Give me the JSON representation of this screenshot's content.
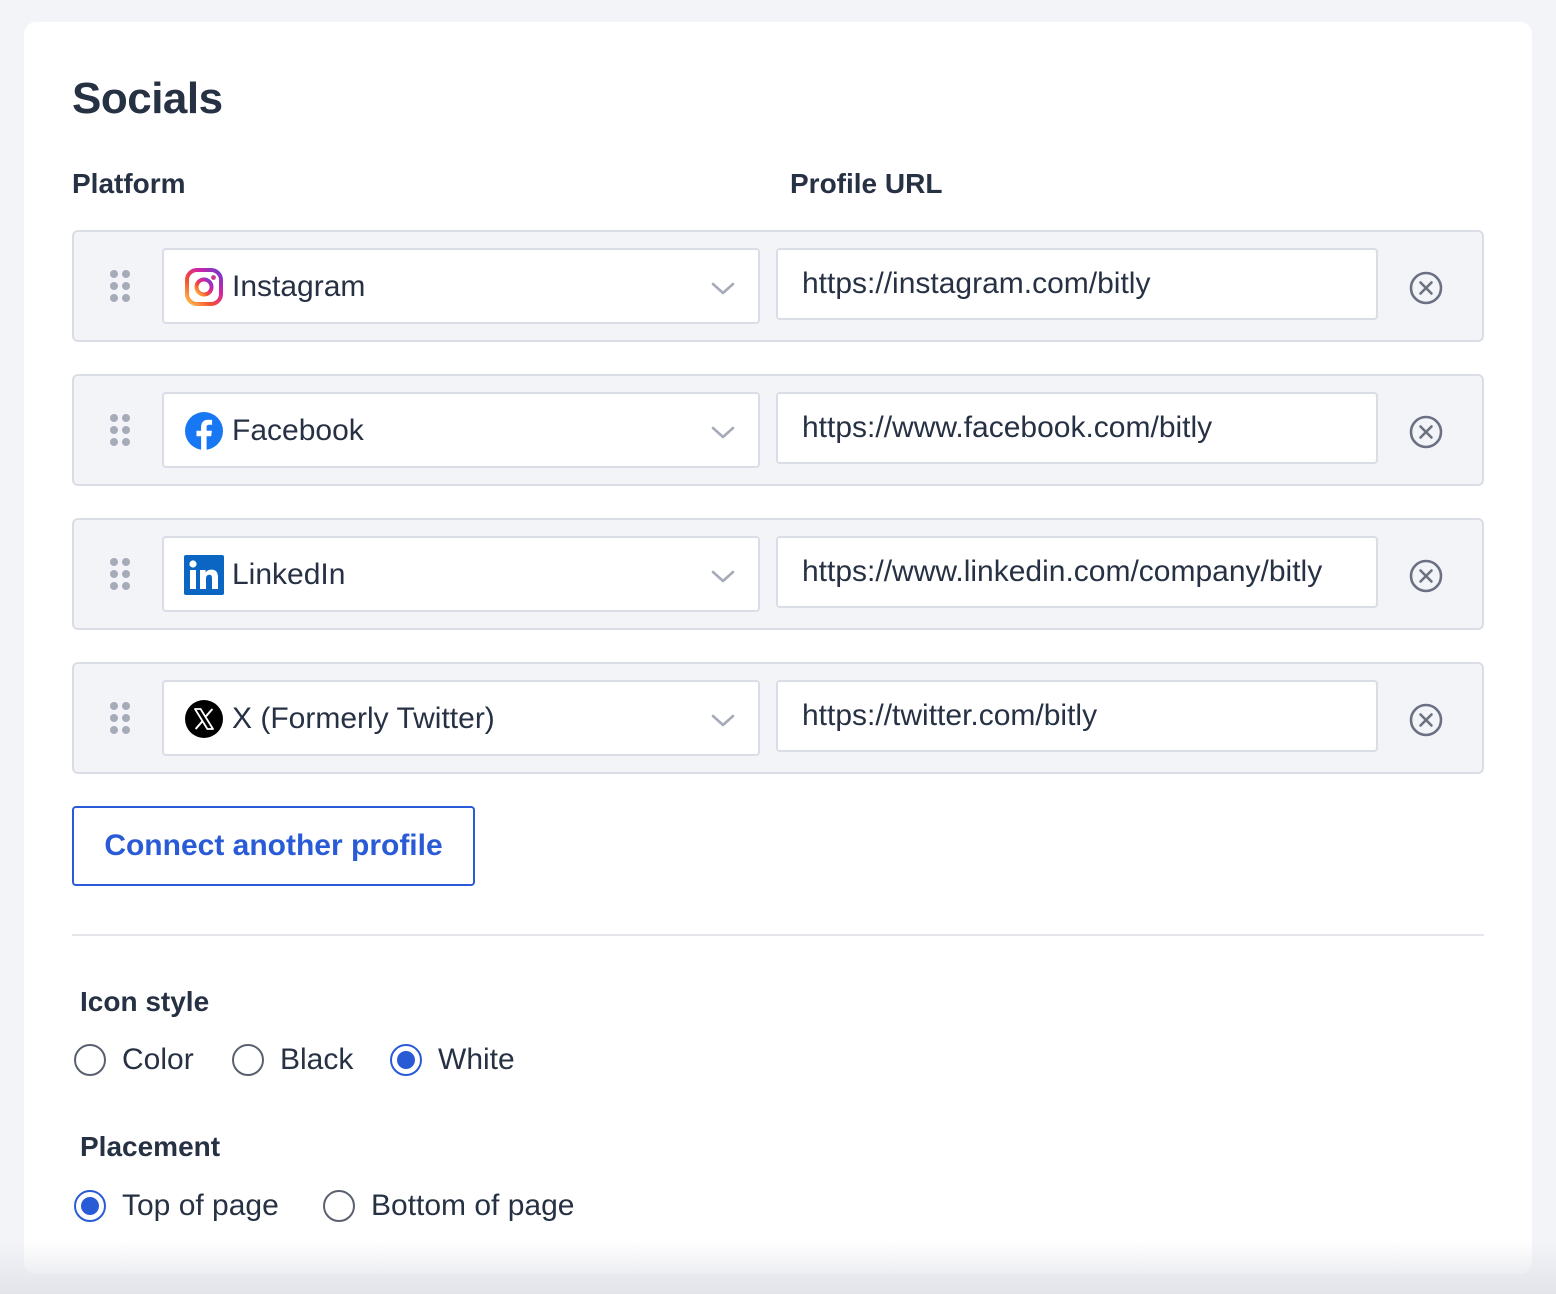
{
  "section": {
    "title": "Socials"
  },
  "columns": {
    "platform": "Platform",
    "profile_url": "Profile URL"
  },
  "socials": [
    {
      "platform": "Instagram",
      "icon": "instagram-icon",
      "url": "https://instagram.com/bitly"
    },
    {
      "platform": "Facebook",
      "icon": "facebook-icon",
      "url": "https://www.facebook.com/bitly"
    },
    {
      "platform": "LinkedIn",
      "icon": "linkedin-icon",
      "url": "https://www.linkedin.com/company/bitly"
    },
    {
      "platform": "X (Formerly Twitter)",
      "icon": "x-twitter-icon",
      "url": "https://twitter.com/bitly"
    }
  ],
  "connect_button": {
    "label": "Connect another profile"
  },
  "icon_style": {
    "label": "Icon style",
    "options": [
      "Color",
      "Black",
      "White"
    ],
    "selected": "White"
  },
  "placement": {
    "label": "Placement",
    "options": [
      "Top of page",
      "Bottom of page"
    ],
    "selected": "Top of page"
  },
  "colors": {
    "accent": "#2a5bd7",
    "text": "#273144",
    "row_background": "#f3f4f8",
    "border": "#dadde6",
    "facebook": "#1877f2",
    "linkedin": "#0a66c2",
    "x": "#000000"
  }
}
